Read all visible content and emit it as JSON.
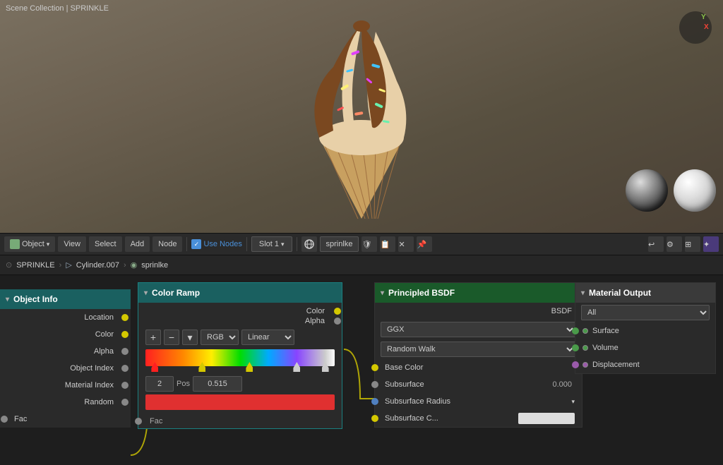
{
  "viewport": {
    "title": "Scene Collection | SPRINKLE"
  },
  "toolbar": {
    "object_label": "Object",
    "view_label": "View",
    "select_label": "Select",
    "add_label": "Add",
    "node_label": "Node",
    "use_nodes_label": "Use Nodes",
    "slot_label": "Slot 1",
    "material_name": "sprinlke",
    "pin_icon": "📌"
  },
  "breadcrumb": {
    "scene": "SPRINKLE",
    "object": "Cylinder.007",
    "material": "sprinlke"
  },
  "object_info_node": {
    "title": "Object Info",
    "outputs": [
      "Location",
      "Color",
      "Alpha",
      "Object Index",
      "Material Index",
      "Random"
    ],
    "fac_label": "Fac"
  },
  "color_ramp_node": {
    "title": "Color Ramp",
    "outputs": [
      "Color",
      "Alpha"
    ],
    "controls": {
      "add_label": "+",
      "remove_label": "−",
      "interpolation_label": "▾",
      "color_mode": "RGB",
      "interpolation": "Linear",
      "index_label": "2",
      "pos_label": "Pos",
      "pos_value": "0.515"
    }
  },
  "principled_node": {
    "title": "Principled BSDF",
    "outputs": [
      "BSDF"
    ],
    "distribution": "GGX",
    "subsurface_method": "Random Walk",
    "base_color_label": "Base Color",
    "subsurface_label": "Subsurface",
    "subsurface_value": "0.000",
    "subsurface_radius_label": "Subsurface Radius",
    "subsurface_c_label": "Subsurface C..."
  },
  "material_output_node": {
    "title": "Material Output",
    "target": "All",
    "inputs": [
      "Surface",
      "Volume",
      "Displacement"
    ]
  },
  "colors": {
    "teal_header": "#1a7070",
    "green_header": "#1a6030",
    "socket_yellow": "#d4c800",
    "socket_gray": "#888888",
    "socket_blue": "#5080c0",
    "socket_green": "#4a9a4a",
    "socket_purple": "#9a5aaa"
  }
}
